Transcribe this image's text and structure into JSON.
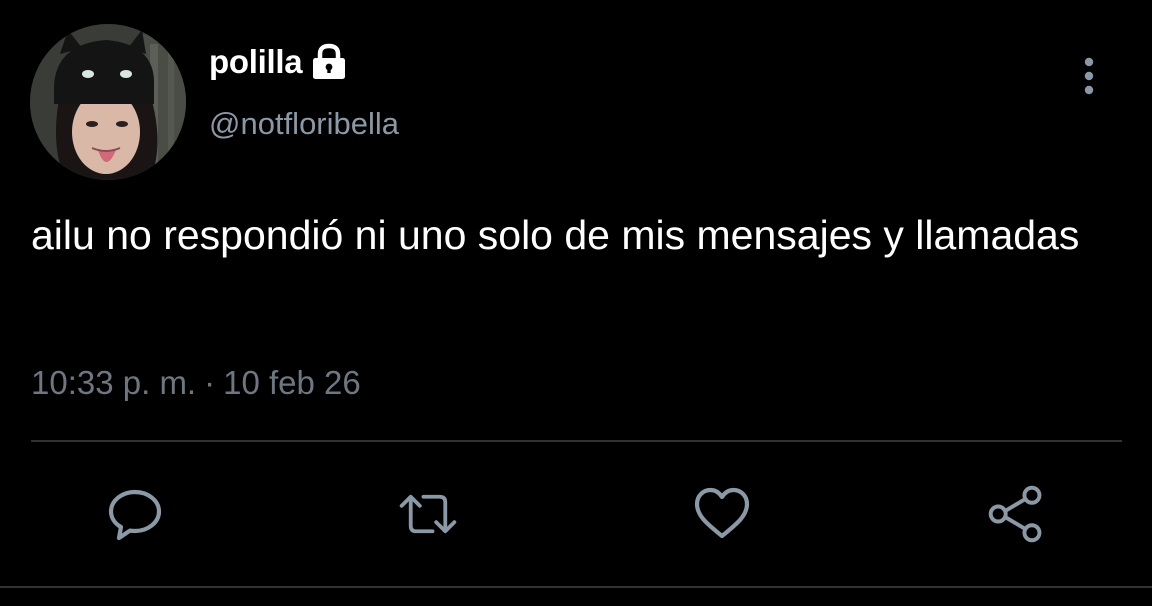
{
  "tweet": {
    "display_name": "polilla",
    "handle": "@notfloribella",
    "protected_icon": "lock-icon",
    "text": "ailu no respondió ni uno solo de mis mensajes y llamadas",
    "time": "10:33 p. m.",
    "separator": "·",
    "date": "10 feb 26"
  },
  "actions": [
    {
      "icon": "reply-icon"
    },
    {
      "icon": "retweet-icon"
    },
    {
      "icon": "like-icon"
    },
    {
      "icon": "share-icon"
    }
  ],
  "menu": {
    "icon": "more-vertical-icon"
  },
  "colors": {
    "background": "#000000",
    "primary_text": "#ffffff",
    "secondary_text": "#8b98a5",
    "icon": "#8b98a5",
    "divider": "#2f3336"
  }
}
